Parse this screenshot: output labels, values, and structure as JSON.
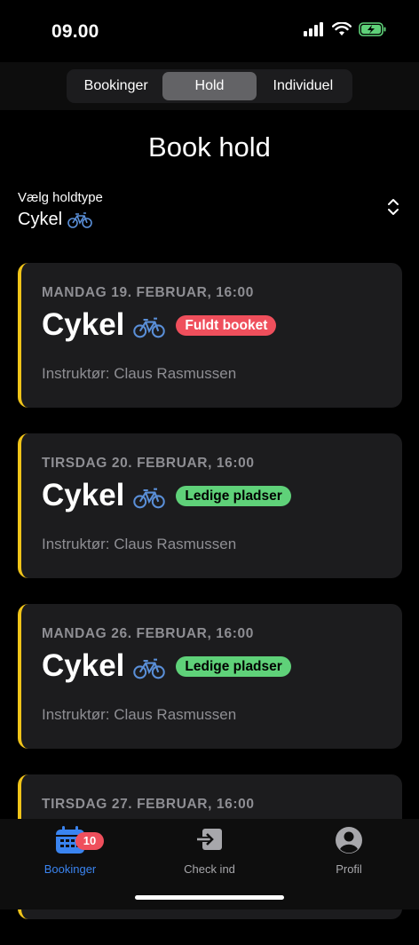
{
  "status": {
    "time": "09.00"
  },
  "segments": [
    {
      "label": "Bookinger",
      "active": false
    },
    {
      "label": "Hold",
      "active": true
    },
    {
      "label": "Individuel",
      "active": false
    }
  ],
  "page": {
    "title": "Book hold"
  },
  "picker": {
    "label": "Vælg holdtype",
    "value": "Cykel"
  },
  "cards": [
    {
      "date": "MANDAG 19. FEBRUAR, 16:00",
      "title": "Cykel",
      "badge": "Fuldt booket",
      "status": "full",
      "instructor": "Instruktør: Claus Rasmussen"
    },
    {
      "date": "TIRSDAG 20. FEBRUAR, 16:00",
      "title": "Cykel",
      "badge": "Ledige pladser",
      "status": "free",
      "instructor": "Instruktør: Claus Rasmussen"
    },
    {
      "date": "MANDAG 26. FEBRUAR, 16:00",
      "title": "Cykel",
      "badge": "Ledige pladser",
      "status": "free",
      "instructor": "Instruktør: Claus Rasmussen"
    },
    {
      "date": "TIRSDAG 27. FEBRUAR, 16:00",
      "title": "",
      "badge": "",
      "status": "",
      "instructor": ""
    }
  ],
  "tabbar": {
    "bookings": {
      "label": "Bookinger",
      "badge": "10",
      "icon": "calendar-icon"
    },
    "checkin": {
      "label": "Check ind",
      "icon": "check-in-icon"
    },
    "profile": {
      "label": "Profil",
      "icon": "profile-icon"
    }
  },
  "colors": {
    "accent": "#3a84f0",
    "card_border": "#f0c419",
    "badge_full": "#ef4f5c",
    "badge_free": "#5fd179"
  }
}
